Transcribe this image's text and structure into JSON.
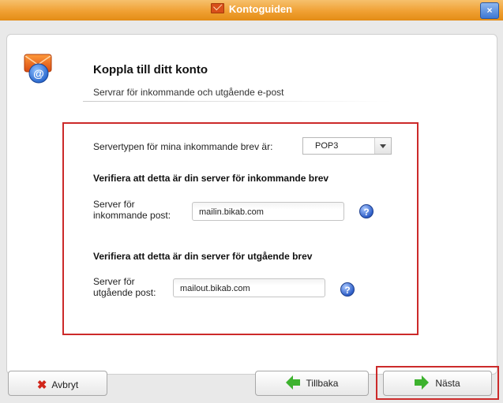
{
  "window": {
    "title": "Kontoguiden",
    "close_label": "×"
  },
  "header": {
    "title": "Koppla till ditt konto",
    "subtitle": "Servrar för inkommande och utgående e-post"
  },
  "server_type": {
    "label": "Servertypen för mina inkommande brev är:",
    "selected": "POP3"
  },
  "incoming": {
    "heading": "Verifiera att detta är din server för inkommande brev",
    "label_line1": "Server för",
    "label_line2": "inkommande post:",
    "value": "mailin.bikab.com",
    "help": "?"
  },
  "outgoing": {
    "heading": "Verifiera att detta är din server för utgående brev",
    "label_line1": "Server för",
    "label_line2": "utgående post:",
    "value": "mailout.bikab.com",
    "help": "?"
  },
  "buttons": {
    "cancel": "Avbryt",
    "back": "Tillbaka",
    "next": "Nästa"
  },
  "colors": {
    "titlebar": "#f0a033",
    "highlight": "#cc2a2a",
    "arrow": "#3db22e"
  }
}
